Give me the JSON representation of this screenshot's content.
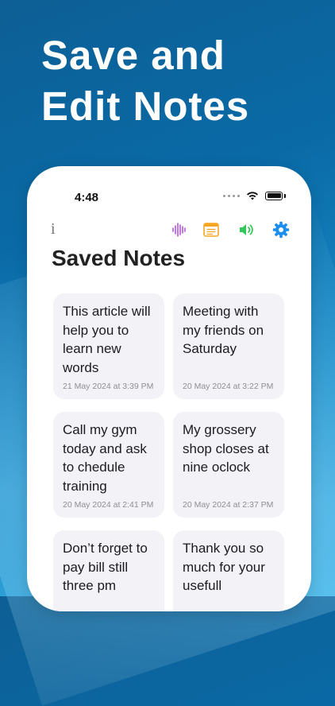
{
  "headline": {
    "line1": "Save and",
    "line2": "Edit Notes"
  },
  "status": {
    "time": "4:48"
  },
  "toolbar": {
    "info_label": "i",
    "icons": [
      "waveform-icon",
      "notes-icon",
      "speaker-icon",
      "gear-icon"
    ]
  },
  "page": {
    "title": "Saved Notes"
  },
  "notes": [
    {
      "text": "This article will help you to learn new words",
      "date": "21 May 2024 at 3:39 PM"
    },
    {
      "text": "Meeting with my friends on Saturday",
      "date": "20 May 2024 at 3:22 PM"
    },
    {
      "text": "Call my gym today and ask to chedule training",
      "date": "20 May 2024 at 2:41 PM"
    },
    {
      "text": "My grossery shop closes at nine oclock",
      "date": "20 May 2024 at 2:37 PM"
    },
    {
      "text": "Don’t forget to pay bill still three pm",
      "date": ""
    },
    {
      "text": "Thank you so much for your usefull",
      "date": ""
    }
  ],
  "colors": {
    "accent_blue": "#1c8ef0",
    "purple": "#b455d8",
    "yellow": "#f5a623",
    "green": "#34c759"
  }
}
